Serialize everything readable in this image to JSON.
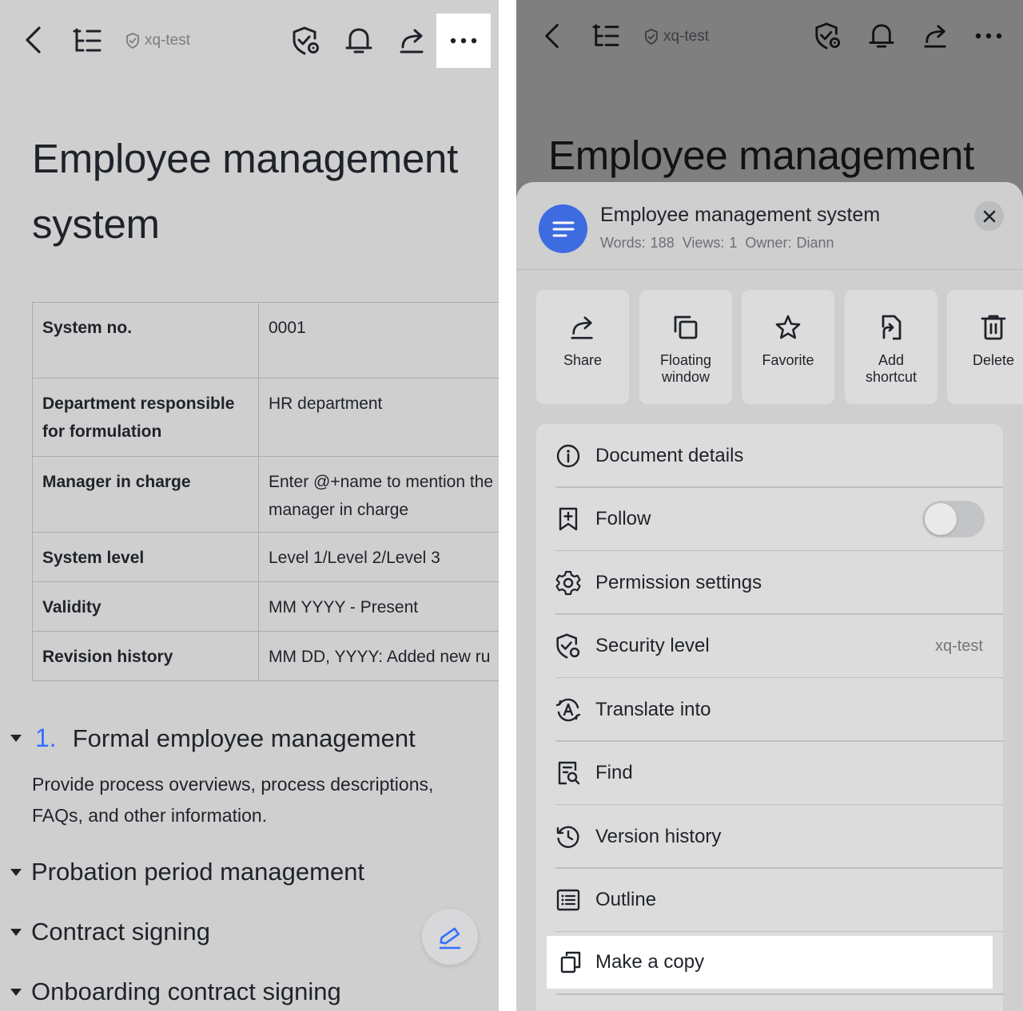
{
  "left": {
    "toolbar": {
      "security_tag": "xq-test"
    },
    "title": "Employee management system",
    "table": [
      {
        "key": "System no.",
        "value": "0001"
      },
      {
        "key": "Department responsible for formulation",
        "value": "HR department"
      },
      {
        "key": "Manager in charge",
        "value": "Enter @+name to mention the manager in charge"
      },
      {
        "key": "System level",
        "value": "Level 1/Level 2/Level 3"
      },
      {
        "key": "Validity",
        "value": "MM YYYY - Present"
      },
      {
        "key": "Revision history",
        "value": "MM DD, YYYY: Added new ru"
      }
    ],
    "section1": {
      "number": "1.",
      "title": "Formal employee management",
      "text": "Provide process overviews, process descriptions, FAQs, and other information."
    },
    "headings": [
      "Probation period management",
      "Contract signing",
      "Onboarding contract signing"
    ]
  },
  "right": {
    "toolbar": {
      "security_tag": "xq-test"
    },
    "bg_title": "Employee management",
    "sheet": {
      "title": "Employee management system",
      "words": "Words: 188",
      "views": "Views: 1",
      "owner": "Owner: Diann"
    },
    "actions": [
      {
        "label": "Share",
        "icon": "share-icon"
      },
      {
        "label": "Floating\nwindow",
        "icon": "floating-window-icon"
      },
      {
        "label": "Favorite",
        "icon": "star-icon"
      },
      {
        "label": "Add\nshortcut",
        "icon": "add-shortcut-icon"
      },
      {
        "label": "Delete",
        "icon": "trash-icon"
      }
    ],
    "menu": [
      {
        "label": "Document details",
        "icon": "info-icon"
      },
      {
        "label": "Follow",
        "icon": "bookmark-plus-icon",
        "toggle": false
      },
      {
        "label": "Permission settings",
        "icon": "gear-icon"
      },
      {
        "label": "Security level",
        "icon": "shield-gear-icon",
        "value": "xq-test"
      },
      {
        "label": "Translate into",
        "icon": "translate-icon"
      },
      {
        "label": "Find",
        "icon": "find-icon"
      },
      {
        "label": "Version history",
        "icon": "history-icon"
      },
      {
        "label": "Outline",
        "icon": "outline-icon"
      },
      {
        "label": "Make a copy",
        "icon": "copy-icon"
      }
    ]
  },
  "colors": {
    "accent": "#3370ff",
    "avatar": "#3d6be0",
    "highlight": "#ffffff"
  }
}
